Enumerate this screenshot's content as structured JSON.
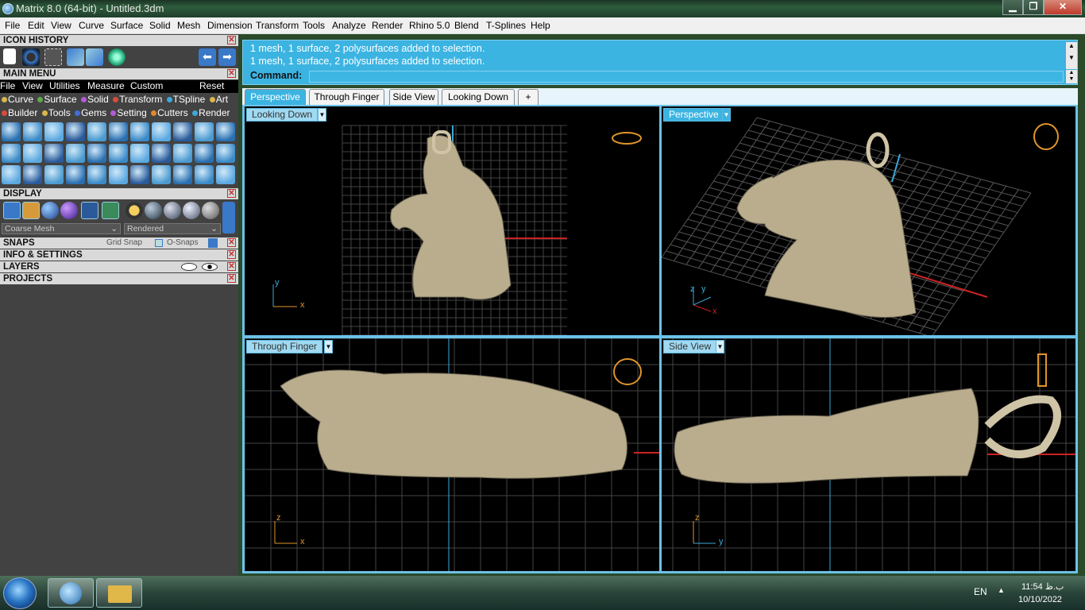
{
  "window": {
    "title": "Matrix 8.0 (64-bit) - Untitled.3dm",
    "min_label": "▁",
    "max_label": "❐",
    "close_label": "✕"
  },
  "menubar": [
    "File",
    "Edit",
    "View",
    "Curve",
    "Surface",
    "Solid",
    "Mesh",
    "Dimension",
    "Transform",
    "Tools",
    "Analyze",
    "Render",
    "Rhino 5.0",
    "Blend",
    "T-Splines",
    "Help"
  ],
  "left": {
    "icon_history": {
      "title": "ICON HISTORY"
    },
    "main_menu": {
      "title": "MAIN MENU",
      "menu": [
        "File",
        "View",
        "Utilities",
        "Measure",
        "Custom"
      ],
      "reset": "Reset",
      "row1": [
        {
          "label": "Curve",
          "color": "#d8b84a"
        },
        {
          "label": "Surface",
          "color": "#5fa84a"
        },
        {
          "label": "Solid",
          "color": "#b45ad8"
        },
        {
          "label": "Transform",
          "color": "#d84a3a"
        },
        {
          "label": "TSpline",
          "color": "#3fa8d8"
        },
        {
          "label": "Art",
          "color": "#d8b84a"
        }
      ],
      "row2": [
        {
          "label": "Builder",
          "color": "#d84a3a"
        },
        {
          "label": "Tools",
          "color": "#d8b84a"
        },
        {
          "label": "Gems",
          "color": "#3f6fd8"
        },
        {
          "label": "Setting",
          "color": "#b45ad8"
        },
        {
          "label": "Cutters",
          "color": "#e08a2a"
        },
        {
          "label": "Render",
          "color": "#3fa8d8"
        }
      ]
    },
    "display": {
      "title": "DISPLAY",
      "mesh_select": "Coarse Mesh",
      "render_select": "Rendered"
    },
    "snaps": {
      "title": "SNAPS",
      "grid_snap": "Grid Snap",
      "osnaps": "O-Snaps"
    },
    "info": {
      "title": "INFO & SETTINGS"
    },
    "layers": {
      "title": "LAYERS"
    },
    "projects": {
      "title": "PROJECTS"
    }
  },
  "command": {
    "history": [
      "1 mesh, 1 surface, 2 polysurfaces added to selection.",
      "1 mesh, 1 surface, 2 polysurfaces added to selection."
    ],
    "prompt": "Command:",
    "value": ""
  },
  "tabs": [
    "Perspective",
    "Through Finger",
    "Side View",
    "Looking Down",
    "+"
  ],
  "viewports": [
    {
      "label": "Looking Down",
      "axis1": "y",
      "axis2": "x"
    },
    {
      "label": "Perspective",
      "axis1": "z",
      "axis2": "y",
      "axis3": "x"
    },
    {
      "label": "Through Finger",
      "axis1": "z",
      "axis2": "x"
    },
    {
      "label": "Side View",
      "axis1": "z",
      "axis2": "y"
    }
  ],
  "taskbar": {
    "lang": "EN",
    "time": "11:54 ب.ظ",
    "date": "10/10/2022"
  }
}
